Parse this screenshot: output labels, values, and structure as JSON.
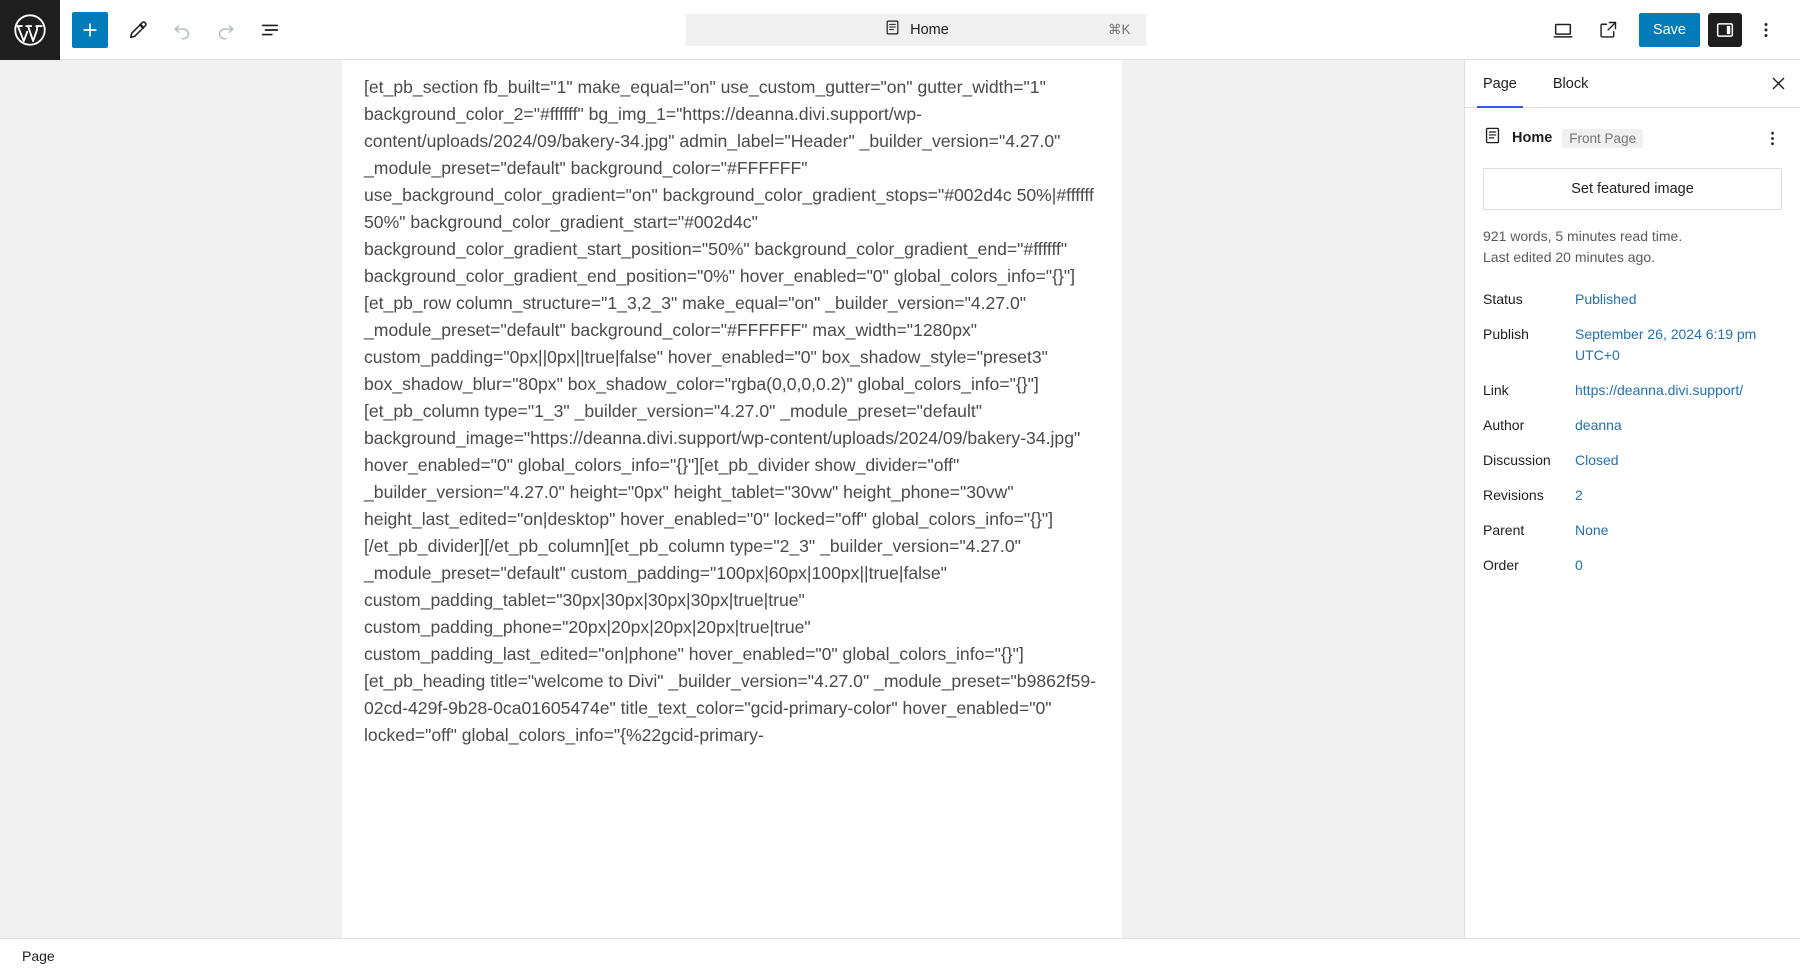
{
  "header": {
    "logo_icon": "wordpress-logo-icon",
    "add_block_icon": "plus-icon",
    "edit_tool_icon": "pencil-icon",
    "undo_icon": "undo-arrow-icon",
    "redo_icon": "redo-arrow-icon",
    "list_view_icon": "document-overview-icon",
    "command_bar": {
      "page_icon": "page-document-icon",
      "title": "Home",
      "shortcut": "⌘K"
    },
    "view_icon": "desktop-device-icon",
    "preview_icon": "external-link-icon",
    "save_label": "Save",
    "sidebar_toggle_icon": "sidebar-panel-icon",
    "options_icon": "ellipsis-vertical-icon",
    "accent_color": "#007cba",
    "logo_background": "#1e1e1e"
  },
  "editor": {
    "shortcode": "[et_pb_section fb_built=\"1\" make_equal=\"on\" use_custom_gutter=\"on\" gutter_width=\"1\" background_color_2=\"#ffffff\" bg_img_1=\"https://deanna.divi.support/wp-content/uploads/2024/09/bakery-34.jpg\" admin_label=\"Header\" _builder_version=\"4.27.0\" _module_preset=\"default\" background_color=\"#FFFFFF\" use_background_color_gradient=\"on\" background_color_gradient_stops=\"#002d4c 50%|#ffffff 50%\" background_color_gradient_start=\"#002d4c\" background_color_gradient_start_position=\"50%\" background_color_gradient_end=\"#ffffff\" background_color_gradient_end_position=\"0%\" hover_enabled=\"0\" global_colors_info=\"{}\"][et_pb_row column_structure=\"1_3,2_3\" make_equal=\"on\" _builder_version=\"4.27.0\" _module_preset=\"default\" background_color=\"#FFFFFF\" max_width=\"1280px\" custom_padding=\"0px||0px||true|false\" hover_enabled=\"0\" box_shadow_style=\"preset3\" box_shadow_blur=\"80px\" box_shadow_color=\"rgba(0,0,0,0.2)\" global_colors_info=\"{}\"][et_pb_column type=\"1_3\" _builder_version=\"4.27.0\" _module_preset=\"default\" background_image=\"https://deanna.divi.support/wp-content/uploads/2024/09/bakery-34.jpg\" hover_enabled=\"0\" global_colors_info=\"{}\"][et_pb_divider show_divider=\"off\" _builder_version=\"4.27.0\" height=\"0px\" height_tablet=\"30vw\" height_phone=\"30vw\" height_last_edited=\"on|desktop\" hover_enabled=\"0\" locked=\"off\" global_colors_info=\"{}\"][/et_pb_divider][/et_pb_column][et_pb_column type=\"2_3\" _builder_version=\"4.27.0\" _module_preset=\"default\" custom_padding=\"100px|60px|100px||true|false\" custom_padding_tablet=\"30px|30px|30px|30px|true|true\" custom_padding_phone=\"20px|20px|20px|20px|true|true\" custom_padding_last_edited=\"on|phone\" hover_enabled=\"0\" global_colors_info=\"{}\"][et_pb_heading title=\"welcome to Divi\" _builder_version=\"4.27.0\" _module_preset=\"b9862f59-02cd-429f-9b28-0ca01605474e\" title_text_color=\"gcid-primary-color\" hover_enabled=\"0\" locked=\"off\" global_colors_info=\"{%22gcid-primary-"
  },
  "sidebar": {
    "tabs": [
      {
        "label": "Page",
        "active": true
      },
      {
        "label": "Block",
        "active": false
      }
    ],
    "close_icon": "close-x-icon",
    "document": {
      "icon": "page-document-icon",
      "title": "Home",
      "badge": "Front Page",
      "kebab_icon": "ellipsis-vertical-icon"
    },
    "featured_image_label": "Set featured image",
    "stats": {
      "word_count": "921 words, 5 minutes read time.",
      "last_edited": "Last edited 20 minutes ago."
    },
    "meta": [
      {
        "label": "Status",
        "value": "Published"
      },
      {
        "label": "Publish",
        "value": "September 26, 2024 6:19 pm UTC+0"
      },
      {
        "label": "Link",
        "value": "https://deanna.divi.support/"
      },
      {
        "label": "Author",
        "value": "deanna"
      },
      {
        "label": "Discussion",
        "value": "Closed"
      },
      {
        "label": "Revisions",
        "value": "2"
      },
      {
        "label": "Parent",
        "value": "None"
      },
      {
        "label": "Order",
        "value": "0"
      }
    ],
    "link_color": "#2271b1",
    "active_tab_color": "#3858e9"
  },
  "footer": {
    "breadcrumb": "Page"
  }
}
